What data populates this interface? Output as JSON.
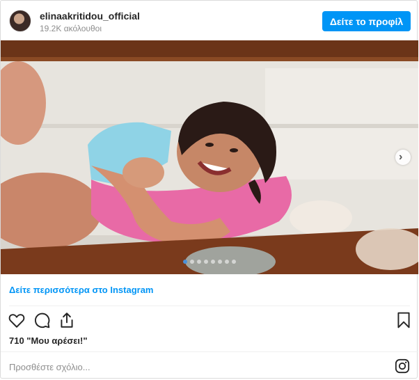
{
  "header": {
    "username": "elinaakritidou_official",
    "followers": "19.2K ακόλουθοι",
    "profile_button": "Δείτε το προφίλ"
  },
  "carousel": {
    "slide_count": 8,
    "active_index": 0
  },
  "post": {
    "more_link": "Δείτε περισσότερα στο Instagram",
    "likes": "710 \"Μου αρέσει!\"",
    "comment_placeholder": "Προσθέστε σχόλιο..."
  },
  "icons": {
    "like": "heart-icon",
    "comment": "comment-icon",
    "share": "share-icon",
    "save": "bookmark-icon",
    "instagram": "instagram-logo-icon",
    "next": "chevron-right-icon"
  },
  "colors": {
    "accent": "#0095f6",
    "text": "#262626",
    "muted": "#8e8e8e"
  }
}
